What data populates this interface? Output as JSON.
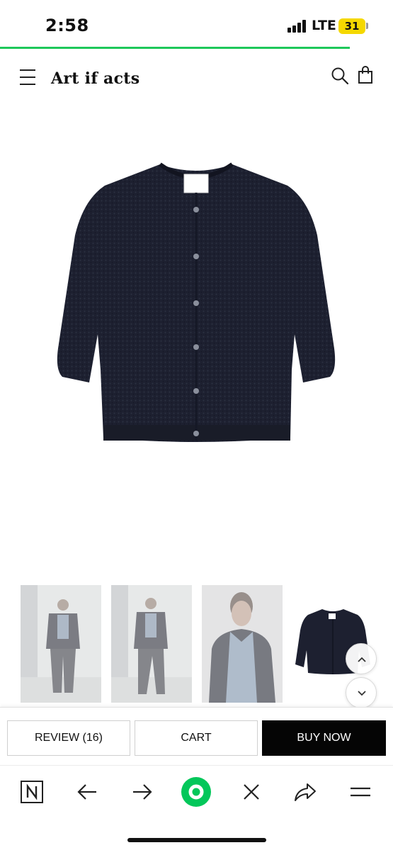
{
  "status_bar": {
    "time": "2:58",
    "network": "LTE",
    "battery": "31"
  },
  "progress": {
    "page_load_fraction": 0.89,
    "color": "#1ec85a"
  },
  "header": {
    "brand": "Art if acts",
    "icons": [
      "hamburger-menu-icon",
      "search-icon",
      "shopping-bag-icon"
    ]
  },
  "product": {
    "main_image": "navy-knit-cardigan",
    "thumbnails": [
      "model-full-body-front",
      "model-full-body-side",
      "model-closeup",
      "cardigan-flat"
    ]
  },
  "actions": {
    "review_label": "REVIEW (16)",
    "cart_label": "CART",
    "buy_label": "BUY NOW"
  },
  "browser_toolbar": {
    "icons": [
      "naver-n-icon",
      "back-arrow-icon",
      "forward-arrow-icon",
      "green-home-icon",
      "close-icon",
      "share-icon",
      "menu-icon"
    ],
    "accent": "#03c75a"
  },
  "colors": {
    "cardigan": "#1c1f2b",
    "buy_button": "#050505"
  }
}
